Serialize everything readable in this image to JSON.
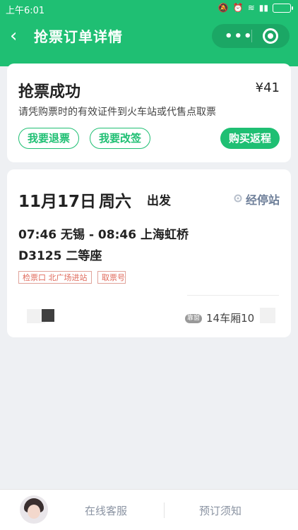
{
  "status_bar": {
    "time": "上午6:01"
  },
  "nav": {
    "title": "抢票订单详情"
  },
  "result_card": {
    "title": "抢票成功",
    "price": "¥41",
    "note": "请凭购票时的有效证件到火车站或代售点取票",
    "refund_label": "我要退票",
    "change_label": "我要改签",
    "return_label": "购买返程"
  },
  "trip_card": {
    "date": "11月17日",
    "weekday": "周六",
    "depart_label": "出发",
    "stops_label": "经停站",
    "route": "07:46 无锡 - 08:46 上海虹桥",
    "train": "D3125  二等座",
    "tags": [
      "检票口 北广场进站",
      "取票号"
    ],
    "seat_badge": "靠窗",
    "seat": "14车厢10"
  },
  "footer": {
    "service_label": "在线客服",
    "notice_label": "预订须知"
  },
  "colors": {
    "brand": "#1fbf73",
    "tag": "#e06a5b",
    "link": "#6e7f99"
  }
}
